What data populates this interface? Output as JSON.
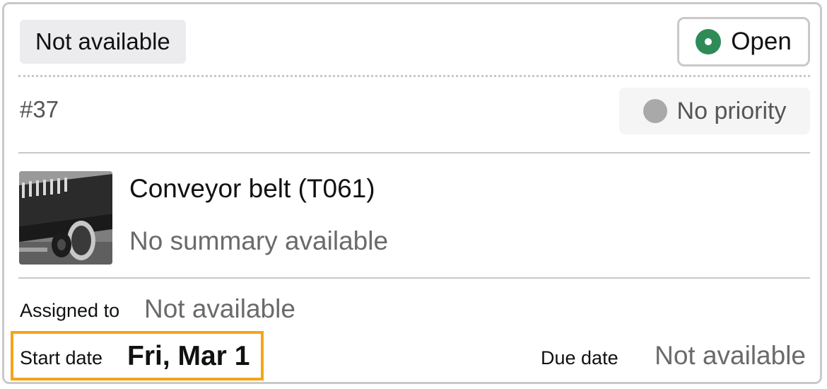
{
  "header": {
    "tag_label": "Not available",
    "status": {
      "label": "Open",
      "color": "#2e8b57"
    }
  },
  "meta": {
    "id": "#37",
    "priority": {
      "label": "No priority",
      "color": "#a9a9a9"
    }
  },
  "asset": {
    "name": "Conveyor belt (T061)",
    "summary": "No summary available",
    "thumbnail_icon": "conveyor-belt-photo"
  },
  "details": {
    "assigned_label": "Assigned to",
    "assigned_value": "Not available",
    "start_label": "Start date",
    "start_value": "Fri, Mar 1",
    "due_label": "Due date",
    "due_value": "Not available",
    "highlight_color": "#f5a516"
  }
}
